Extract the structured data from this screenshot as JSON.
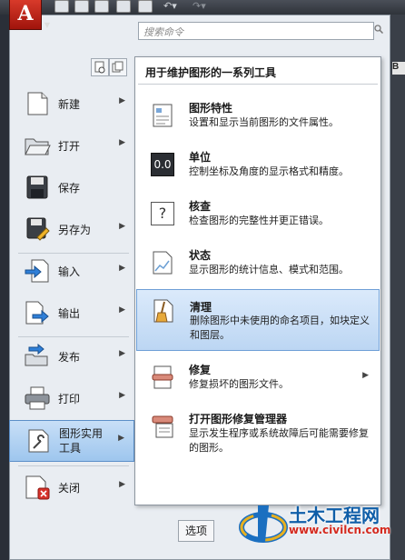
{
  "app": {
    "logo_letter": "A"
  },
  "search": {
    "placeholder": "搜索命令"
  },
  "left_menu": {
    "items": [
      {
        "label": "新建",
        "icon": "new-file-icon",
        "has_submenu": true
      },
      {
        "label": "打开",
        "icon": "open-folder-icon",
        "has_submenu": true
      },
      {
        "label": "保存",
        "icon": "save-disk-icon",
        "has_submenu": false
      },
      {
        "label": "另存为",
        "icon": "save-as-icon",
        "has_submenu": true
      },
      {
        "label": "输入",
        "icon": "import-icon",
        "has_submenu": true
      },
      {
        "label": "输出",
        "icon": "export-icon",
        "has_submenu": true
      },
      {
        "label": "发布",
        "icon": "publish-icon",
        "has_submenu": true
      },
      {
        "label": "打印",
        "icon": "print-icon",
        "has_submenu": true
      },
      {
        "label": "图形实用工具",
        "label_line1": "图形实用",
        "label_line2": "工具",
        "icon": "drawing-utilities-icon",
        "has_submenu": true,
        "selected": true
      },
      {
        "label": "关闭",
        "icon": "close-file-icon",
        "has_submenu": true
      }
    ]
  },
  "submenu": {
    "title": "用于维护图形的一系列工具",
    "items": [
      {
        "title": "图形特性",
        "desc": "设置和显示当前图形的文件属性。",
        "icon": "drawing-properties-icon"
      },
      {
        "title": "单位",
        "desc": "控制坐标及角度的显示格式和精度。",
        "icon": "units-icon",
        "icon_text": "0.0"
      },
      {
        "title": "核查",
        "desc": "检查图形的完整性并更正错误。",
        "icon": "audit-icon",
        "icon_text": "?"
      },
      {
        "title": "状态",
        "desc": "显示图形的统计信息、模式和范围。",
        "icon": "status-icon"
      },
      {
        "title": "清理",
        "desc": "删除图形中未使用的命名项目，如块定义和图层。",
        "icon": "purge-broom-icon",
        "selected": true
      },
      {
        "title": "修复",
        "desc": "修复损坏的图形文件。",
        "icon": "recover-icon",
        "has_submenu": true
      },
      {
        "title": "打开图形修复管理器",
        "desc": "显示发生程序或系统故障后可能需要修复的图形。",
        "icon": "recovery-manager-icon"
      }
    ]
  },
  "options_button": "选项",
  "edge_letter": "B",
  "watermark": {
    "name": "土木工程网",
    "url": "www.civilcn.com"
  },
  "colors": {
    "logo_red": "#c8281b",
    "selection_blue": "#9ec6ee",
    "watermark_blue": "#0f5ea8",
    "watermark_red": "#d42a1f"
  }
}
